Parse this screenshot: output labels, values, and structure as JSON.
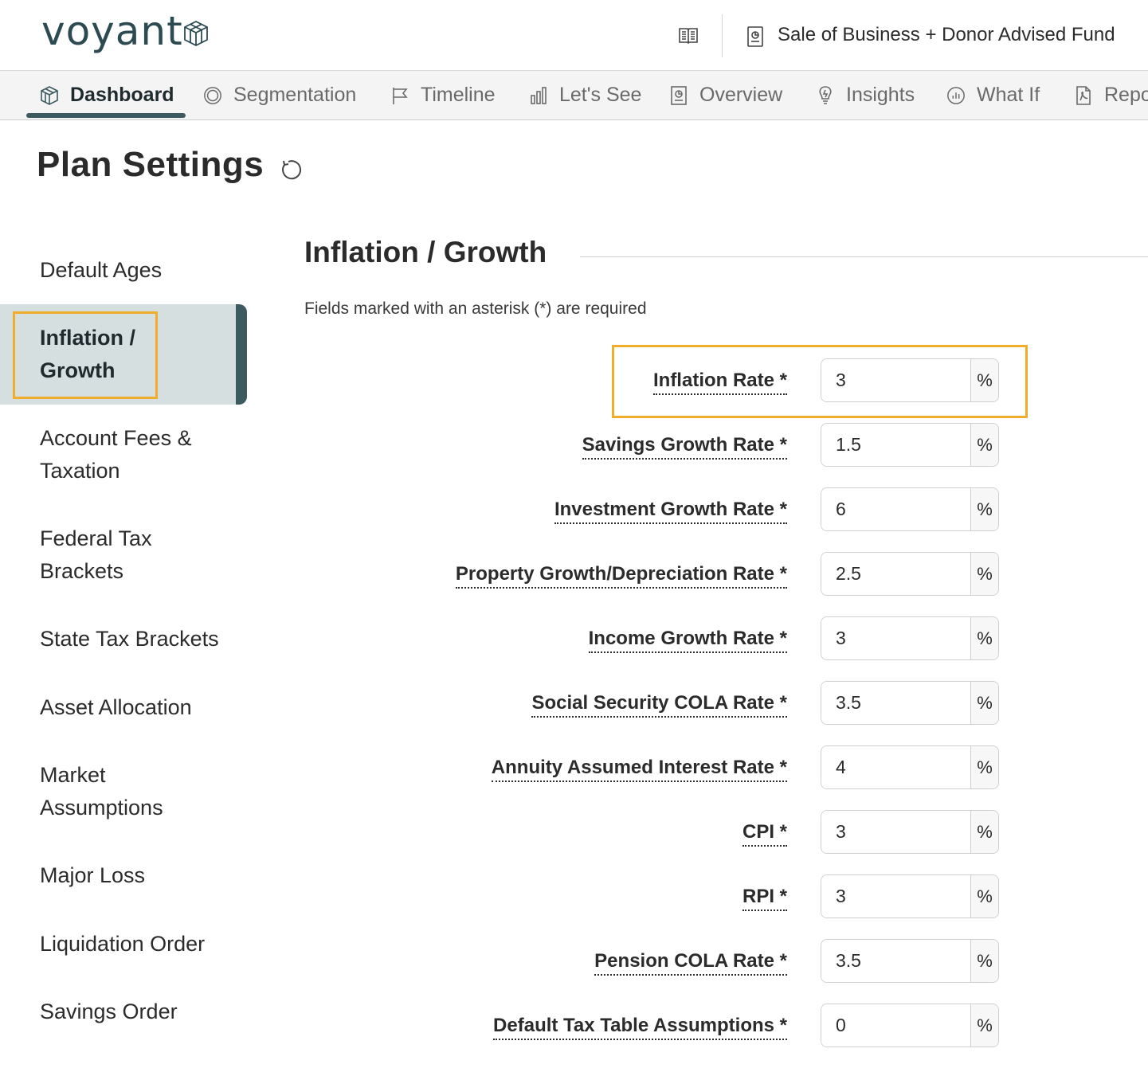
{
  "header": {
    "logo_text": "voyant",
    "plan_title": "Sale of Business + Donor Advised Fund"
  },
  "nav": {
    "tabs": [
      {
        "label": "Dashboard",
        "icon": "cube-icon",
        "active": true
      },
      {
        "label": "Segmentation",
        "icon": "circle-icon"
      },
      {
        "label": "Timeline",
        "icon": "flag-icon"
      },
      {
        "label": "Let's See",
        "icon": "bar-chart-icon"
      },
      {
        "label": "Overview",
        "icon": "document-chart-icon"
      },
      {
        "label": "Insights",
        "icon": "lightbulb-icon"
      },
      {
        "label": "What If",
        "icon": "gauge-icon"
      },
      {
        "label": "Repo",
        "icon": "pdf-icon"
      }
    ]
  },
  "page": {
    "title": "Plan Settings"
  },
  "sidebar": {
    "items": [
      {
        "label": "Default Ages"
      },
      {
        "label": "Inflation / Growth",
        "active": true
      },
      {
        "label": "Account Fees & Taxation"
      },
      {
        "label": "Federal Tax Brackets"
      },
      {
        "label": "State Tax Brackets"
      },
      {
        "label": "Asset Allocation"
      },
      {
        "label": "Market Assumptions"
      },
      {
        "label": "Major Loss"
      },
      {
        "label": "Liquidation Order"
      },
      {
        "label": "Savings Order"
      }
    ]
  },
  "section": {
    "title": "Inflation / Growth",
    "required_note": "Fields marked with an asterisk (*) are required"
  },
  "fields": [
    {
      "label": "Inflation Rate *",
      "value": "3",
      "suffix": "%"
    },
    {
      "label": "Savings Growth Rate *",
      "value": "1.5",
      "suffix": "%"
    },
    {
      "label": "Investment Growth Rate *",
      "value": "6",
      "suffix": "%"
    },
    {
      "label": "Property Growth/Depreciation Rate *",
      "value": "2.5",
      "suffix": "%"
    },
    {
      "label": "Income Growth Rate *",
      "value": "3",
      "suffix": "%"
    },
    {
      "label": "Social Security COLA Rate *",
      "value": "3.5",
      "suffix": "%"
    },
    {
      "label": "Annuity Assumed Interest Rate *",
      "value": "4",
      "suffix": "%"
    },
    {
      "label": "CPI *",
      "value": "3",
      "suffix": "%"
    },
    {
      "label": "RPI *",
      "value": "3",
      "suffix": "%"
    },
    {
      "label": "Pension COLA Rate *",
      "value": "3.5",
      "suffix": "%"
    },
    {
      "label": "Default Tax Table Assumptions *",
      "value": "0",
      "suffix": "%"
    }
  ],
  "colors": {
    "accent": "#3c5a5f",
    "highlight": "#f0ad2b",
    "active_bg": "#d5dfdf"
  }
}
